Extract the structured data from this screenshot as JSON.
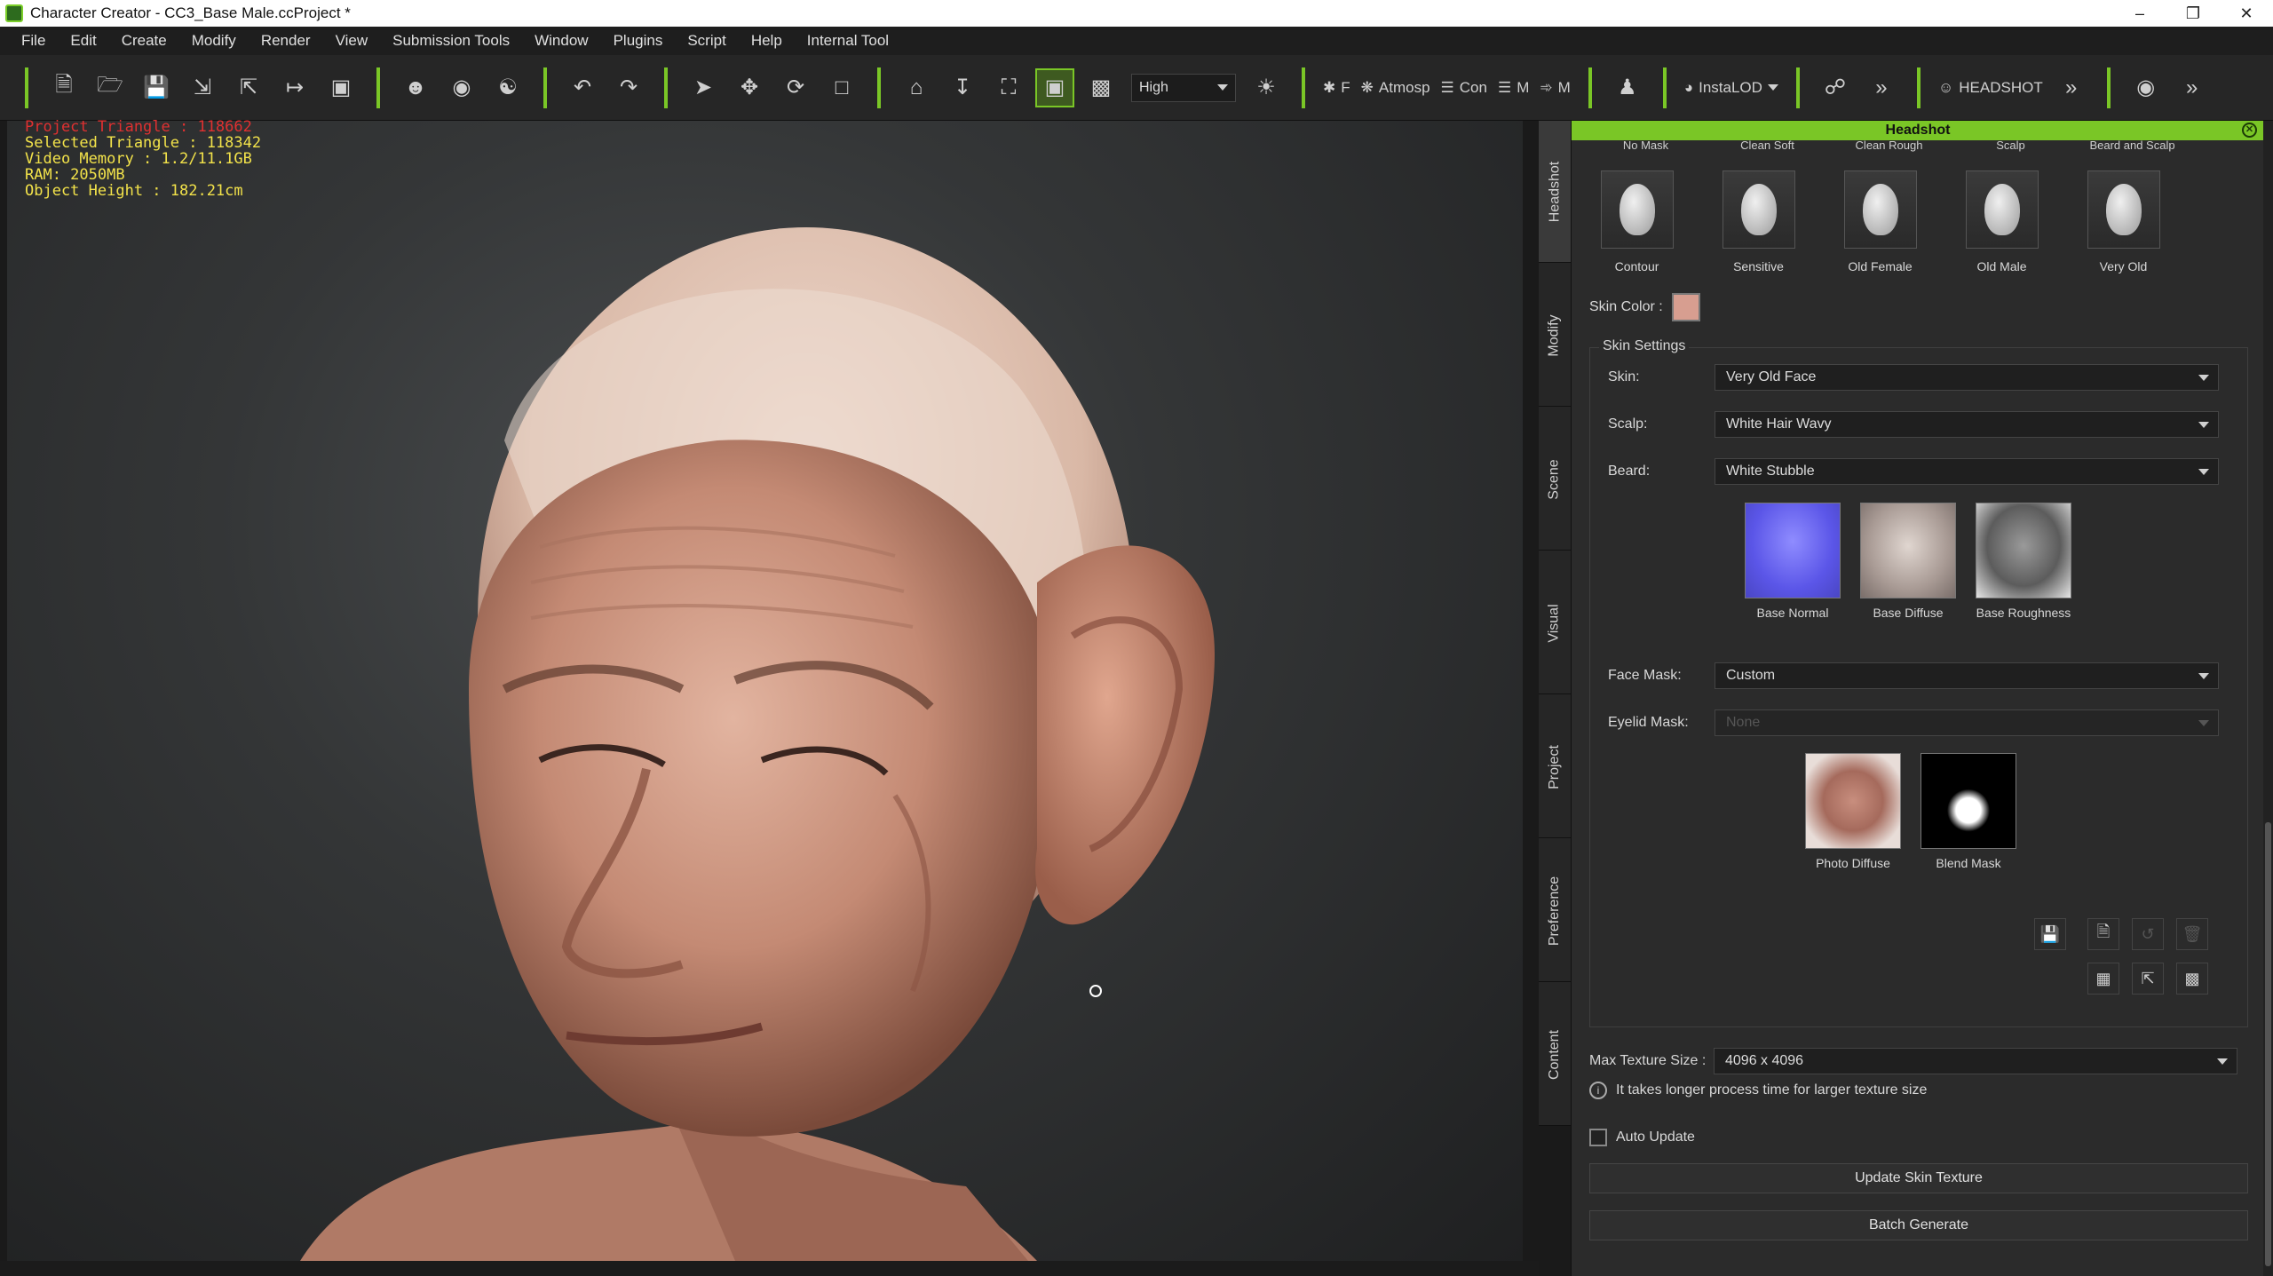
{
  "window": {
    "title": "Character Creator - CC3_Base Male.ccProject *"
  },
  "menu": [
    "File",
    "Edit",
    "Create",
    "Modify",
    "Render",
    "View",
    "Submission Tools",
    "Window",
    "Plugins",
    "Script",
    "Help",
    "Internal Tool"
  ],
  "toolbar": {
    "quality": "High",
    "atmosphere_label": "Atmosp",
    "instalod_label": "InstaLOD",
    "headshot_label": "HEADSHOT",
    "f_label": "F",
    "con_label": "Con",
    "m_label": "M",
    "m2_label": "M"
  },
  "stats": {
    "project_triangle": "Project Triangle : 118662",
    "selected_triangle": "Selected Triangle : 118342",
    "video_memory": "Video Memory : 1.2/11.1GB",
    "ram": "RAM: 2050MB",
    "object_height": "Object Height : 182.21cm"
  },
  "side_tabs": [
    "Headshot",
    "Modify",
    "Scene",
    "Visual",
    "Project",
    "Preference",
    "Content"
  ],
  "panel": {
    "title": "Headshot",
    "cut_labels": [
      "No Mask",
      "Clean Soft",
      "Clean Rough",
      "Scalp",
      "Beard and Scalp"
    ],
    "presets": [
      "Contour",
      "Sensitive",
      "Old Female",
      "Old Male",
      "Very Old"
    ],
    "skin_color_label": "Skin Color :",
    "skin_color": "#d79e90",
    "skin_settings": {
      "title": "Skin Settings",
      "skin_label": "Skin:",
      "skin_value": "Very Old Face",
      "scalp_label": "Scalp:",
      "scalp_value": "White Hair Wavy",
      "beard_label": "Beard:",
      "beard_value": "White Stubble",
      "textures": [
        "Base Normal",
        "Base Diffuse",
        "Base Roughness"
      ],
      "face_mask_label": "Face Mask:",
      "face_mask_value": "Custom",
      "eyelid_mask_label": "Eyelid Mask:",
      "eyelid_mask_value": "None",
      "mask_textures": [
        "Photo Diffuse",
        "Blend Mask"
      ]
    },
    "max_texture_label": "Max Texture Size :",
    "max_texture_value": "4096 x 4096",
    "info_text": "It takes longer process time for larger texture size",
    "auto_update_label": "Auto Update",
    "update_button": "Update Skin Texture",
    "batch_button": "Batch Generate"
  }
}
